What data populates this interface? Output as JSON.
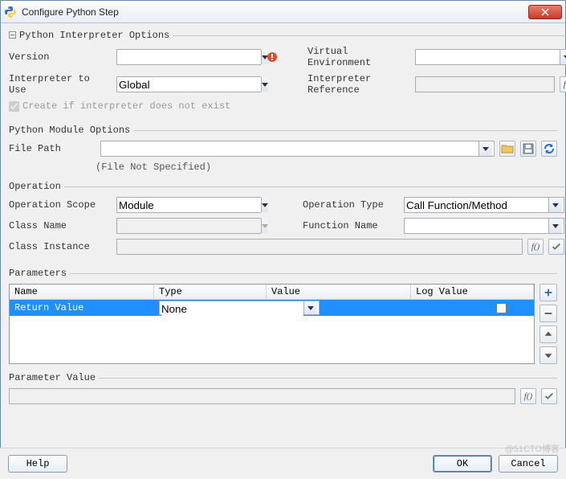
{
  "window": {
    "title": "Configure Python Step"
  },
  "sections": {
    "interpreter": {
      "legend": "Python Interpreter Options",
      "version_label": "Version",
      "version_value": "",
      "virtualenv_label": "Virtual Environment",
      "virtualenv_value": "",
      "interpreter_label": "Interpreter to Use",
      "interpreter_value": "Global",
      "ref_label": "Interpreter Reference",
      "ref_value": "",
      "create_label": "Create if interpreter does not exist"
    },
    "module": {
      "legend": "Python Module Options",
      "filepath_label": "File Path",
      "filepath_value": "",
      "filepath_hint": "(File Not Specified)"
    },
    "operation": {
      "legend": "Operation",
      "scope_label": "Operation Scope",
      "scope_value": "Module",
      "type_label": "Operation Type",
      "type_value": "Call Function/Method",
      "class_label": "Class Name",
      "class_value": "",
      "func_label": "Function Name",
      "func_value": "",
      "instance_label": "Class Instance",
      "instance_value": ""
    },
    "parameters": {
      "legend": "Parameters",
      "headers": {
        "name": "Name",
        "type": "Type",
        "value": "Value",
        "log": "Log Value"
      },
      "rows": [
        {
          "name": "Return Value",
          "type": "None",
          "value": "",
          "log": false
        }
      ],
      "paramvalue_legend": "Parameter Value",
      "paramvalue_value": ""
    }
  },
  "buttons": {
    "help": "Help",
    "ok": "OK",
    "cancel": "Cancel"
  },
  "watermark": "@51CTO博客"
}
